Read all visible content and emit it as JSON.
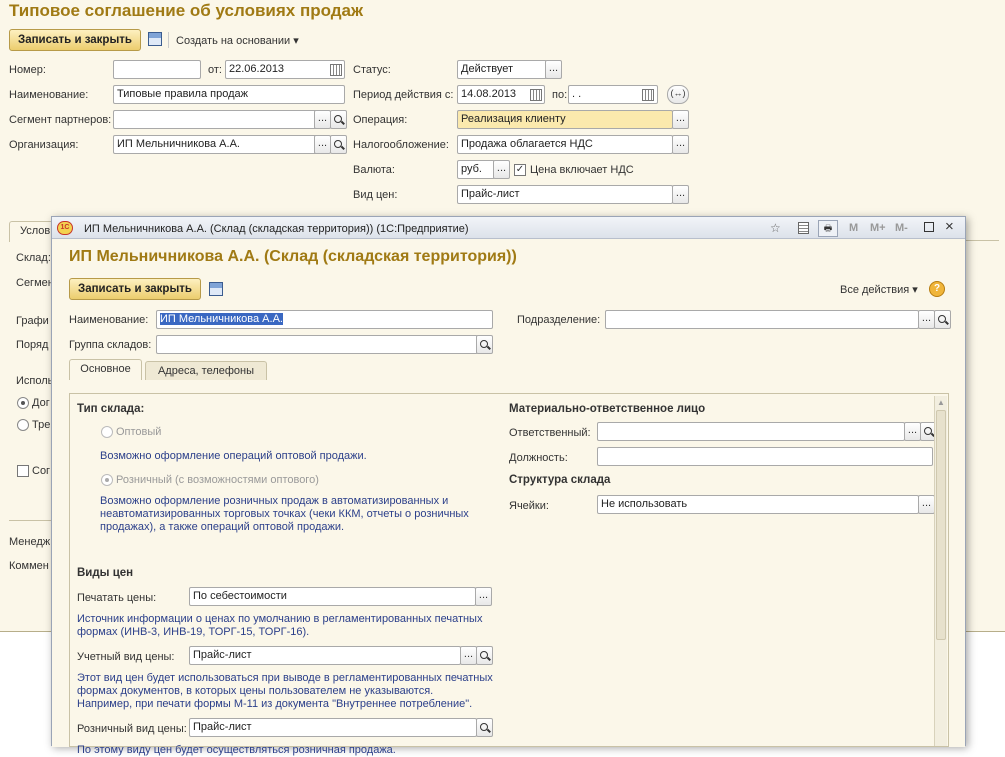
{
  "main": {
    "title": "Типовое соглашение об условиях продаж",
    "save_close": "Записать и закрыть",
    "create_based": "Создать на основании",
    "number_label": "Номер:",
    "number_value": "",
    "from_label": "от:",
    "date_value": "22.06.2013",
    "status_label": "Статус:",
    "status_value": "Действует",
    "name_label": "Наименование:",
    "name_value": "Типовые правила продаж",
    "period_label": "Период действия с:",
    "period_from": "14.08.2013",
    "period_to_label": "по:",
    "period_to": " .  .",
    "segment_label": "Сегмент партнеров:",
    "segment_value": "",
    "operation_label": "Операция:",
    "operation_value": "Реализация клиенту",
    "org_label": "Организация:",
    "org_value": "ИП Мельничникова А.А.",
    "tax_label": "Налогообложение:",
    "tax_value": "Продажа облагается НДС",
    "currency_label": "Валюта:",
    "currency_value": "руб.",
    "vat_check": "Цена включает НДС",
    "pricetype_label": "Вид цен:",
    "pricetype_value": "Прайс-лист",
    "hidden_tab": "Услов",
    "side_labels": [
      "Склад:",
      "Сегмен",
      "Графи",
      "Поряд",
      "Исполь",
      "Дог",
      "Тре",
      "Сог",
      "Менедж",
      "Коммен"
    ]
  },
  "dialog": {
    "window_title": "ИП Мельничникова А.А. (Склад (складская территория))  (1С:Предприятие)",
    "title": "ИП Мельничникова А.А. (Склад (складская территория))",
    "save_close": "Записать и закрыть",
    "all_actions": "Все действия",
    "help": "?",
    "name_label": "Наименование:",
    "name_value": "ИП Мельничникова А.А.",
    "division_label": "Подразделение:",
    "division_value": "",
    "group_label": "Группа складов:",
    "group_value": "",
    "tabs": [
      "Основное",
      "Адреса, телефоны"
    ],
    "warehouse_type_header": "Тип склада:",
    "wholesale_label": "Оптовый",
    "wholesale_hint": "Возможно оформление операций оптовой продажи.",
    "retail_label": "Розничный (с возможностями оптового)",
    "retail_hint": [
      "Возможно оформление розничных продаж в автоматизированных и",
      "неавтоматизированных торговых точках (чеки ККМ, отчеты о розничных",
      "продажах), а также операций оптовой продажи."
    ],
    "mol_header": "Материально-ответственное лицо",
    "responsible_label": "Ответственный:",
    "responsible_value": "",
    "position_label": "Должность:",
    "position_value": "",
    "structure_header": "Структура склада",
    "cells_label": "Ячейки:",
    "cells_value": "Не использовать",
    "price_types_header": "Виды цен",
    "print_prices_label": "Печатать цены:",
    "print_prices_value": "По себестоимости",
    "print_prices_hint": [
      "Источник информации о ценах по умолчанию в регламентированных печатных",
      "формах (ИНВ-3, ИНВ-19, ТОРГ-15, ТОРГ-16)."
    ],
    "account_price_label": "Учетный вид цены:",
    "account_price_value": "Прайс-лист",
    "account_price_hint": [
      "Этот вид цен будет использоваться при выводе в регламентированных печатных",
      "формах документов, в которых цены пользователем не указываются.",
      "Например, при печати формы М-11 из документа \"Внутреннее потребление\"."
    ],
    "retail_price_label": "Розничный вид цены:",
    "retail_price_value": "Прайс-лист",
    "retail_price_hint": "По этому виду цен будет осуществляться розничная продажа.",
    "header_buttons": [
      "M",
      "M+",
      "M-"
    ]
  }
}
